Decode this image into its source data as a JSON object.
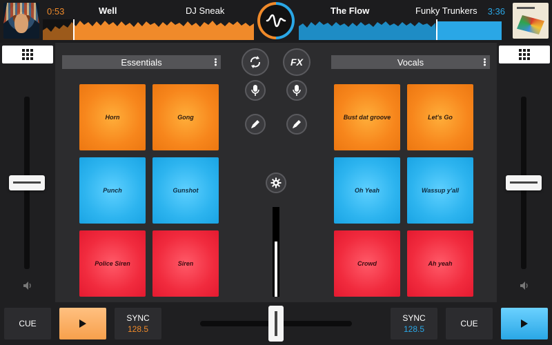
{
  "deck_left": {
    "time": "0:53",
    "title": "Well",
    "artist": "DJ Sneak",
    "color": "#f08a2a",
    "pads_menu": "Essentials",
    "pads": [
      "Horn",
      "Gong",
      "Punch",
      "Gunshot",
      "Police Siren",
      "Siren"
    ],
    "cue_label": "CUE",
    "sync_label": "SYNC",
    "bpm": "128.5"
  },
  "deck_right": {
    "time": "3:36",
    "title": "The Flow",
    "artist": "Funky Trunkers",
    "color": "#2aa7e6",
    "pads_menu": "Vocals",
    "pads": [
      "Bust dat groove",
      "Let's Go",
      "Oh Yeah",
      "Wassup y'all",
      "Crowd",
      "Ah yeah"
    ],
    "cue_label": "CUE",
    "sync_label": "SYNC",
    "bpm": "128.5"
  },
  "center": {
    "fx_label": "FX"
  },
  "icons": [
    "grid-icon",
    "loop-icon",
    "mic-icon",
    "pencil-icon",
    "gear-icon",
    "speaker-icon",
    "play-icon",
    "logo-icon"
  ]
}
